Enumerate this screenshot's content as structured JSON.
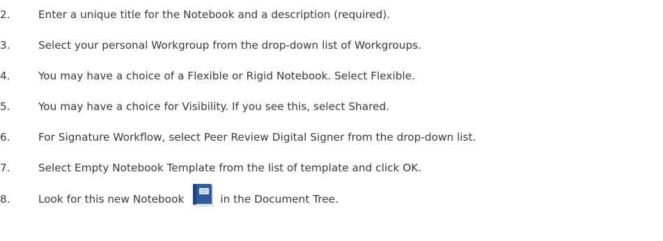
{
  "steps": [
    {
      "number": "2.",
      "text": "Enter a unique title for the Notebook and a description (required)."
    },
    {
      "number": "3.",
      "text": "Select your personal Workgroup from the drop-down list of Workgroups."
    },
    {
      "number": "4.",
      "text": "You may have a choice of a Flexible or Rigid Notebook. Select Flexible."
    },
    {
      "number": "5.",
      "text": "You may have a choice for Visibility.  If you see this, select Shared."
    },
    {
      "number": "6.",
      "text": "For Signature Workflow, select Peer Review Digital Signer from the drop-down list."
    },
    {
      "number": "7.",
      "text": "Select Empty Notebook Template from the list of template and click OK."
    },
    {
      "number": "8.",
      "text_before": "Look for this new Notebook",
      "icon": "notebook-icon",
      "text_after": "in the Document Tree."
    }
  ]
}
